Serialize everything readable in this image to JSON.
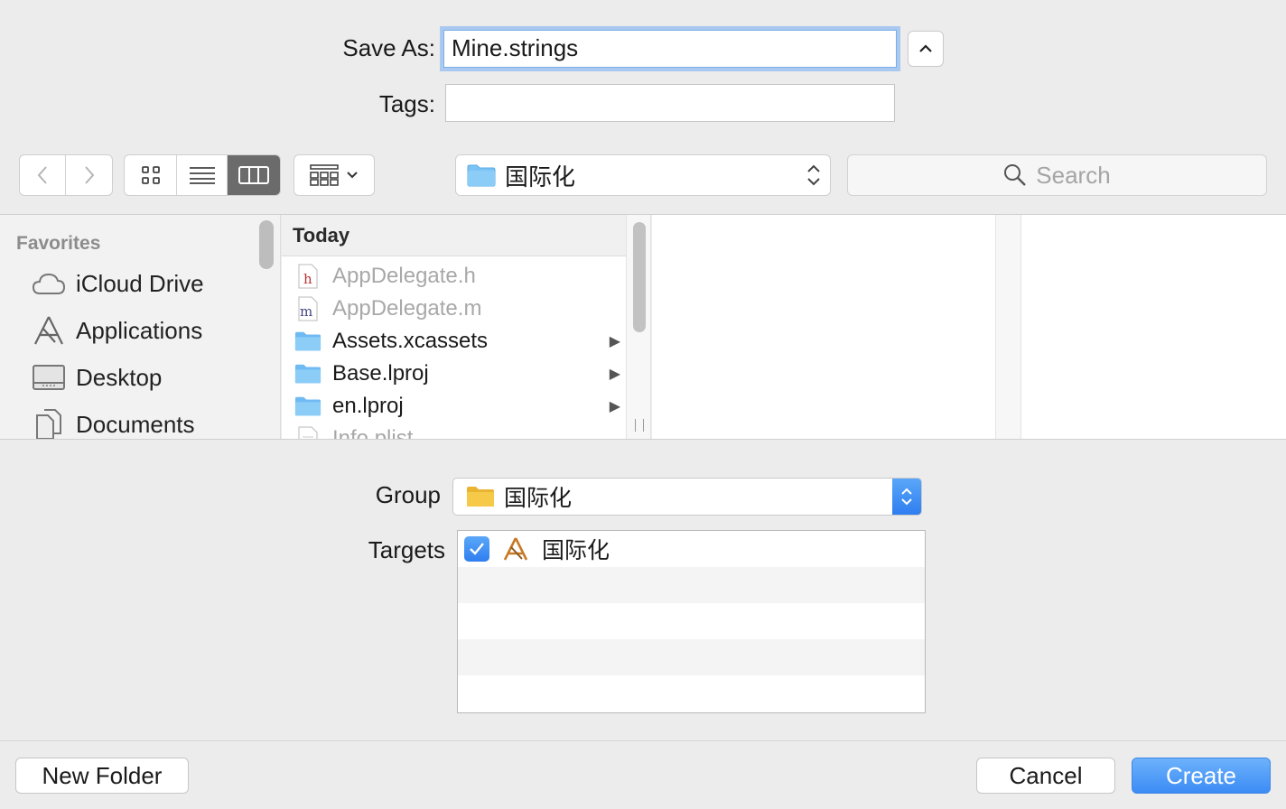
{
  "form": {
    "save_as_label": "Save As:",
    "save_as_value": "Mine.strings",
    "tags_label": "Tags:",
    "tags_value": ""
  },
  "toolbar": {
    "location": "国际化",
    "search_placeholder": "Search",
    "view_modes": [
      "icon-view",
      "list-view",
      "column-view"
    ],
    "active_view": "column-view"
  },
  "sidebar": {
    "heading": "Favorites",
    "items": [
      {
        "label": "iCloud Drive",
        "icon": "cloud-icon"
      },
      {
        "label": "Applications",
        "icon": "applications-icon"
      },
      {
        "label": "Desktop",
        "icon": "desktop-icon"
      },
      {
        "label": "Documents",
        "icon": "documents-icon"
      }
    ]
  },
  "browser": {
    "column_heading": "Today",
    "files": [
      {
        "name": "AppDelegate.h",
        "icon": "header-file-icon",
        "enabled": false,
        "folder": false
      },
      {
        "name": "AppDelegate.m",
        "icon": "source-file-icon",
        "enabled": false,
        "folder": false
      },
      {
        "name": "Assets.xcassets",
        "icon": "folder-icon",
        "enabled": true,
        "folder": true
      },
      {
        "name": "Base.lproj",
        "icon": "folder-icon",
        "enabled": true,
        "folder": true
      },
      {
        "name": "en.lproj",
        "icon": "folder-icon",
        "enabled": true,
        "folder": true
      },
      {
        "name": "Info.plist",
        "icon": "plist-file-icon",
        "enabled": false,
        "folder": false
      }
    ]
  },
  "options": {
    "group_label": "Group",
    "group_value": "国际化",
    "targets_label": "Targets",
    "targets": [
      {
        "name": "国际化",
        "checked": true
      }
    ]
  },
  "buttons": {
    "new_folder": "New Folder",
    "cancel": "Cancel",
    "create": "Create"
  },
  "colors": {
    "accent": "#3c8cf5",
    "focus_ring": "#a9c9f1",
    "folder_blue": "#7cc3f5",
    "folder_yellow": "#f7c948"
  }
}
